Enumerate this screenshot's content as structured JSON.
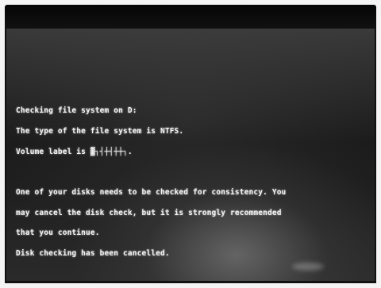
{
  "console": {
    "line1": "Checking file system on D:",
    "line2": "The type of the file system is NTFS.",
    "line3": "Volume label is ▓┐┤┼┤┼┼┐.",
    "line4": "One of your disks needs to be checked for consistency. You",
    "line5": "may cancel the disk check, but it is strongly recommended",
    "line6": "that you continue.",
    "line7": "Disk checking has been cancelled."
  }
}
